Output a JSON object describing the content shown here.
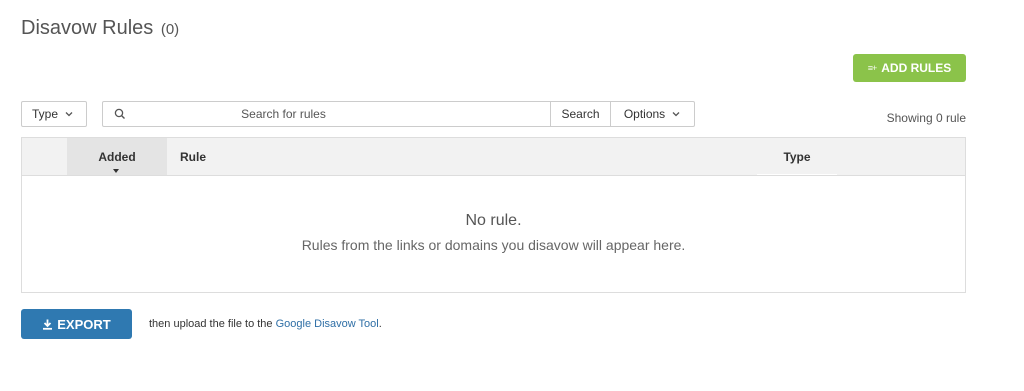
{
  "header": {
    "title": "Disavow Rules",
    "count": "(0)"
  },
  "actions": {
    "add_rules_label": "ADD RULES",
    "add_rules_icon": "list-add-icon"
  },
  "toolbar": {
    "type_filter_label": "Type",
    "search_placeholder": "Search for rules",
    "search_value": "",
    "search_button_label": "Search",
    "options_label": "Options",
    "showing_text": "Showing 0 rule"
  },
  "table": {
    "columns": [
      {
        "label": "Added",
        "sorted": "desc"
      },
      {
        "label": "Rule"
      },
      {
        "label": "Type"
      }
    ],
    "rows": [],
    "empty_title": "No rule.",
    "empty_description": "Rules from the links or domains you disavow will appear here."
  },
  "footer": {
    "export_label": "EXPORT",
    "export_icon": "download-icon",
    "note_prefix": "then upload the file to the ",
    "note_link": "Google Disavow Tool",
    "note_suffix": "."
  },
  "colors": {
    "add_button": "#8bc34a",
    "export_button": "#2f79b1",
    "link": "#2f6fa6",
    "header_bg": "#f2f2f2",
    "sorted_column_bg": "#e4e4e4"
  }
}
